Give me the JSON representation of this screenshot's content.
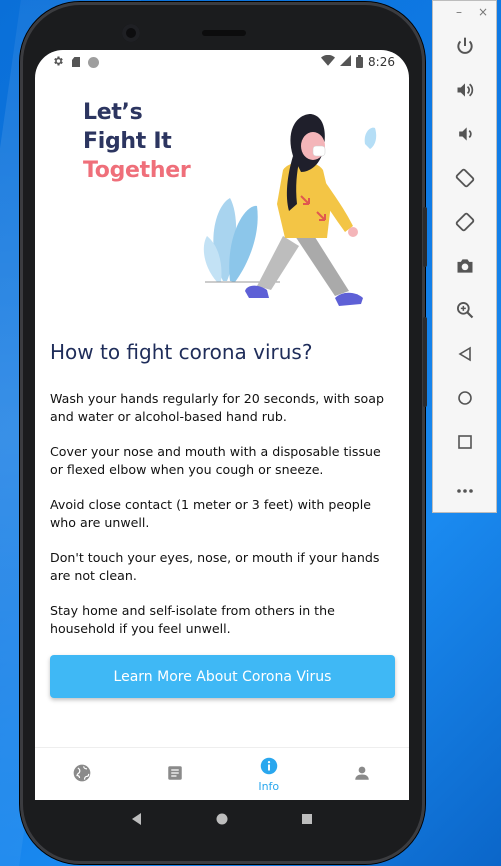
{
  "status_bar": {
    "time": "8:26"
  },
  "hero": {
    "line1": "Let’s",
    "line2": "Fight It",
    "line3": "Together"
  },
  "content": {
    "title": "How to fight corona virus?",
    "tips": [
      "Wash your hands regularly for 20 seconds, with soap and water or alcohol-based hand rub.",
      "Cover your nose and mouth with a disposable tissue or flexed elbow when you cough or sneeze.",
      "Avoid close contact (1 meter or 3 feet) with people who are unwell.",
      "Don't touch your eyes, nose, or mouth if your hands are not clean.",
      "Stay home and self-isolate from others in the household if you feel unwell."
    ],
    "cta_label": "Learn More About Corona Virus"
  },
  "bottom_nav": {
    "items": [
      {
        "icon": "globe-icon",
        "label": ""
      },
      {
        "icon": "article-icon",
        "label": ""
      },
      {
        "icon": "info-icon",
        "label": "Info",
        "active": true
      },
      {
        "icon": "person-icon",
        "label": ""
      }
    ]
  },
  "emulator_panel": {
    "window_controls": [
      "–",
      "×"
    ],
    "tools": [
      "power-icon",
      "volume-up-icon",
      "volume-down-icon",
      "rotate-left-icon",
      "rotate-right-icon",
      "camera-icon",
      "zoom-icon",
      "back-icon",
      "home-icon",
      "overview-icon",
      "more-icon"
    ]
  },
  "colors": {
    "accent": "#3fb8f5",
    "title_navy": "#2c3560",
    "title_pink": "#ef6f7a",
    "active_tab": "#2aa7ee"
  }
}
